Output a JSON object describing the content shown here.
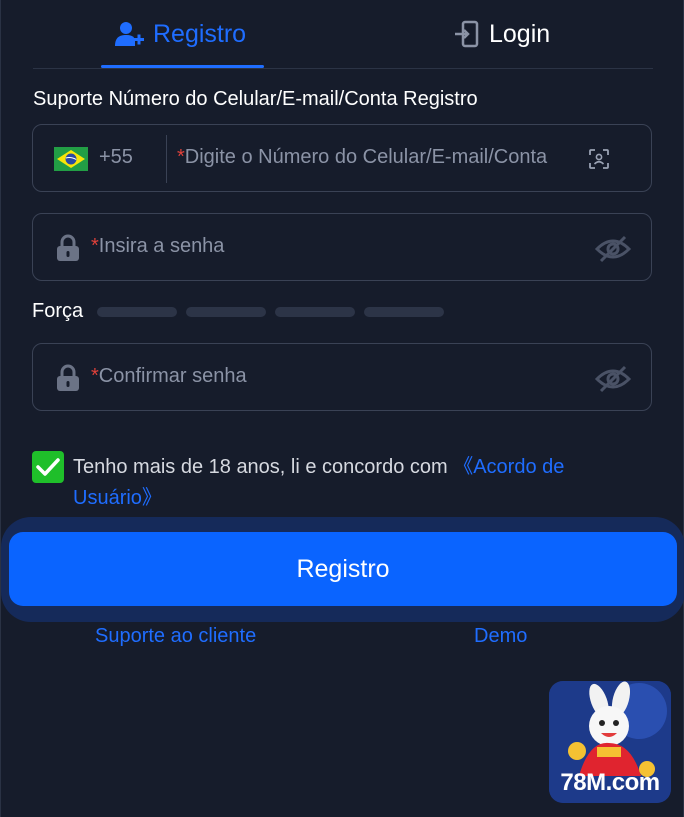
{
  "tabs": {
    "register_label": "Registro",
    "login_label": "Login"
  },
  "form": {
    "support_label": "Suporte Número do Celular/E-mail/Conta Registro",
    "country_code": "+55",
    "required_mark": "*",
    "account_placeholder": "Digite o Número do Celular/E-mail/Conta",
    "password_placeholder": "Insira a senha",
    "strength_label": "Força",
    "strength_level": 0,
    "confirm_placeholder": "Confirmar senha"
  },
  "agreement": {
    "checked": true,
    "text": "Tenho mais de 18 anos, li e concordo com ",
    "link_text": "《Acordo de Usuário》"
  },
  "submit_label": "Registro",
  "links": {
    "support": "Suporte ao cliente",
    "demo": "Demo"
  },
  "logo": {
    "text": "78M.com"
  },
  "colors": {
    "accent": "#1f6dff",
    "button": "#0a64ff",
    "checkbox": "#1fbf2a",
    "background": "#161c2b"
  }
}
